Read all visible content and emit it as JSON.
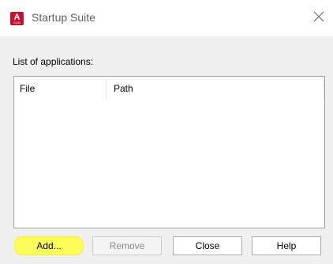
{
  "window": {
    "title": "Startup Suite",
    "app_icon": {
      "name": "autocad-app-icon",
      "letter": "A",
      "sub_text": "CAD"
    },
    "close_icon": "close-icon"
  },
  "list": {
    "label": "List of applications:",
    "columns": [
      "File",
      "Path"
    ],
    "rows": []
  },
  "buttons": {
    "add": "Add...",
    "remove": "Remove",
    "close": "Close",
    "help": "Help"
  },
  "colors": {
    "app_icon_red": "#c8102e",
    "add_highlight": "#fdfd5a"
  }
}
